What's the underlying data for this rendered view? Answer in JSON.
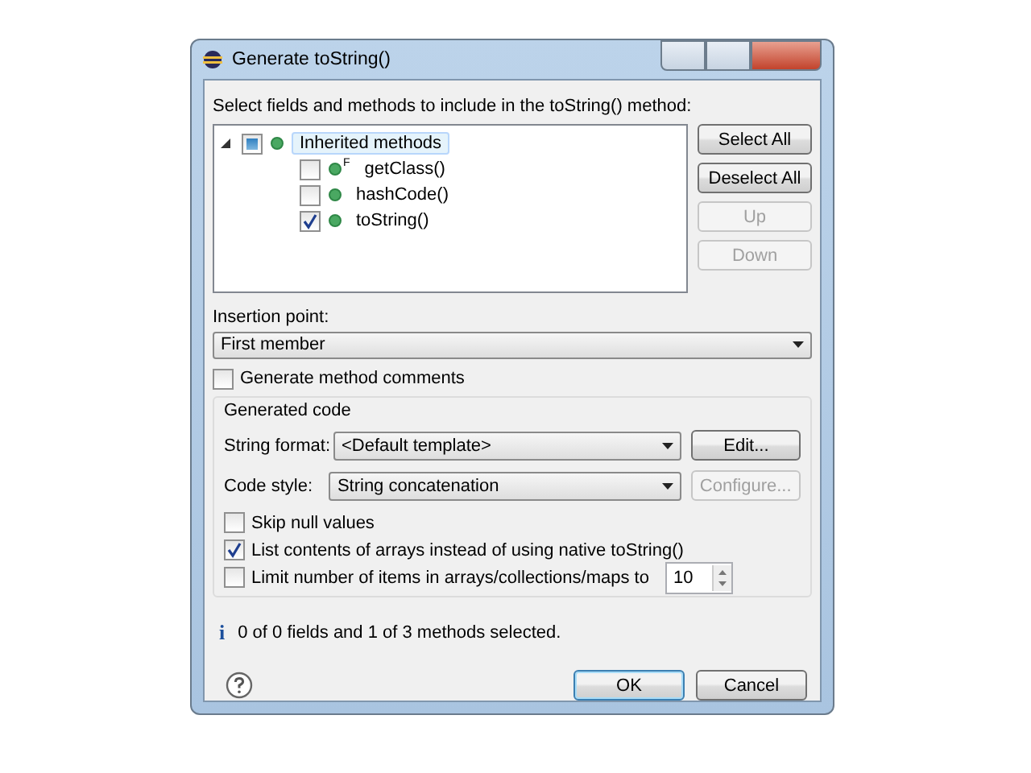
{
  "window": {
    "title": "Generate toString()"
  },
  "members": {
    "label": "Select fields and methods to include in the toString() method:",
    "tree": [
      {
        "label": "Inherited methods",
        "expanded": true,
        "selected": true,
        "partial": true,
        "children": [
          {
            "label": "getClass()",
            "badge": "F",
            "checked": false,
            "selected": false
          },
          {
            "label": "hashCode()",
            "checked": false,
            "selected": false
          },
          {
            "label": "toString()",
            "checked": true,
            "selected": false
          }
        ]
      }
    ]
  },
  "side_buttons": [
    {
      "label": "Select All",
      "disabled": false
    },
    {
      "label": "Deselect All",
      "disabled": false
    },
    {
      "label": "Up",
      "disabled": true
    },
    {
      "label": "Down",
      "disabled": true
    }
  ],
  "insertion_point": {
    "label": "Insertion point:",
    "value": "First member"
  },
  "generate_comments": {
    "label": "Generate method comments",
    "checked": false
  },
  "generated_code": {
    "title": "Generated code",
    "string_format": {
      "label": "String format:",
      "value": "<Default template>",
      "button": {
        "label": "Edit...",
        "disabled": false
      }
    },
    "code_style": {
      "label": "Code style:",
      "value": "String concatenation",
      "button": {
        "label": "Configure...",
        "disabled": true
      }
    },
    "options": [
      {
        "kind": "check",
        "label": "Skip null values",
        "checked": false
      },
      {
        "kind": "check",
        "label": "List contents of arrays instead of using native toString()",
        "checked": true
      },
      {
        "kind": "spinner",
        "label": "Limit number of items in arrays/collections/maps to",
        "checked": false,
        "value": "10"
      }
    ]
  },
  "status": {
    "icon": "i",
    "text": "0 of 0 fields and 1 of 3 methods selected."
  },
  "buttons": [
    {
      "label": "OK",
      "default": true
    },
    {
      "label": "Cancel",
      "default": false
    }
  ]
}
